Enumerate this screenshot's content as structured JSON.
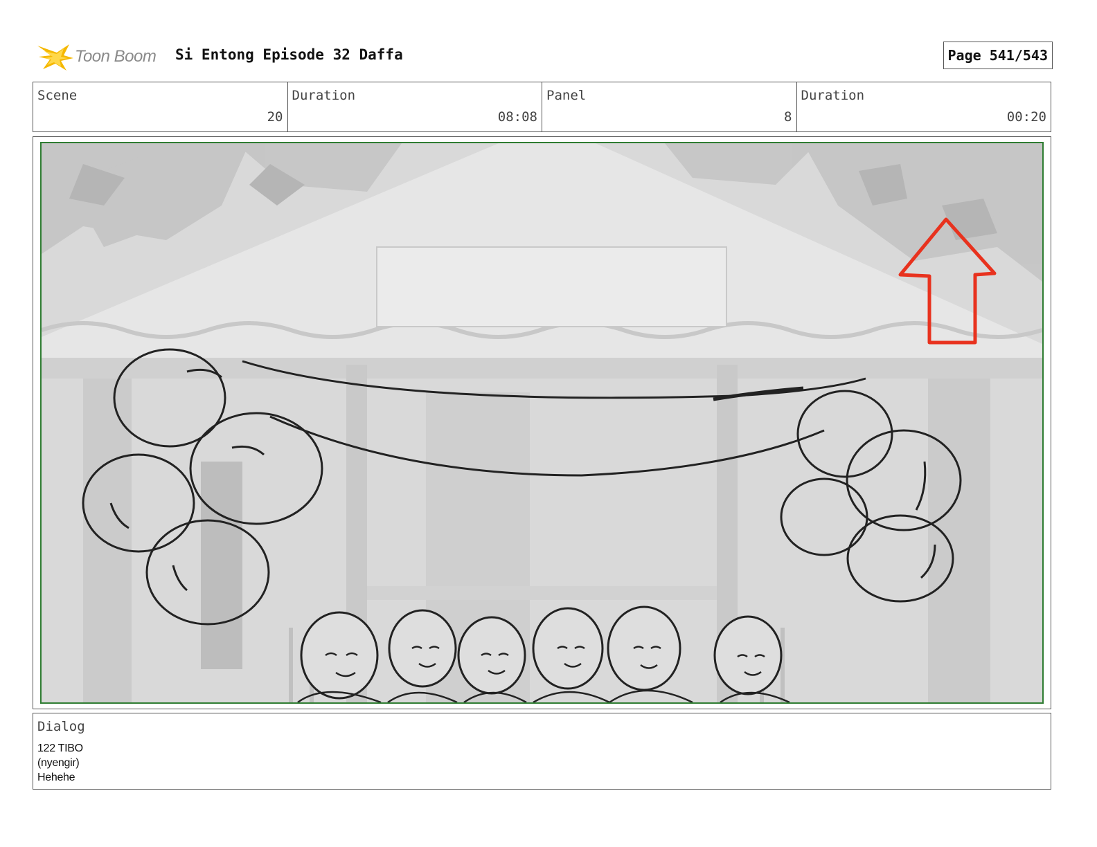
{
  "header": {
    "logo_text": "Toon Boom",
    "project_title": "Si Entong Episode 32 Daffa",
    "page_label": "Page 541/543"
  },
  "info": {
    "scene_label": "Scene",
    "scene_value": "20",
    "scene_duration_label": "Duration",
    "scene_duration_value": "08:08",
    "panel_label": "Panel",
    "panel_value": "8",
    "panel_duration_label": "Duration",
    "panel_duration_value": "00:20"
  },
  "dialog": {
    "label": "Dialog",
    "lines": [
      "122 TIBO",
      "(nyengir)",
      "Hehehe"
    ]
  },
  "colors": {
    "frame_border": "#2f7d32",
    "arrow": "#e8321e",
    "logo_star": "#f5b800",
    "sketch_line": "#222222",
    "background_gray": "#d4d4d4"
  }
}
